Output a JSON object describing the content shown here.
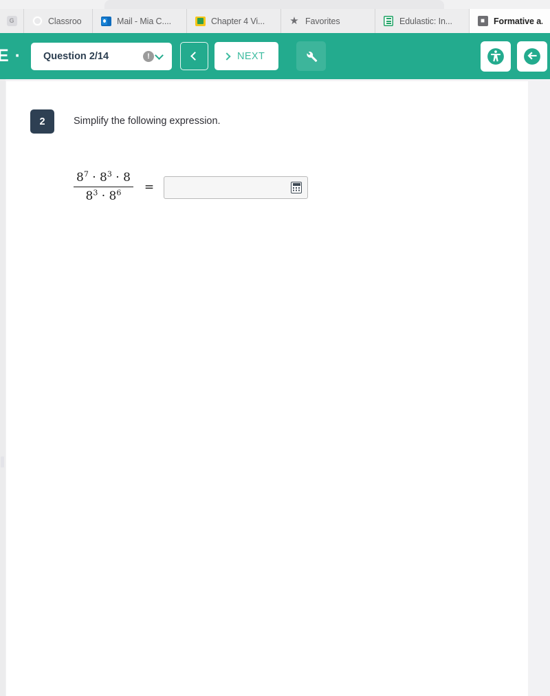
{
  "browser": {
    "tabs": [
      {
        "label": "",
        "icon": "g-suite-icon",
        "active": false,
        "pinned": true
      },
      {
        "label": "Classroo",
        "icon": "google-classroom-icon",
        "active": false,
        "pinned": false
      },
      {
        "label": "Mail - Mia C....",
        "icon": "outlook-icon",
        "active": false,
        "pinned": false
      },
      {
        "label": "Chapter 4 Vi...",
        "icon": "document-icon",
        "active": false,
        "pinned": false
      },
      {
        "label": "Favorites",
        "icon": "star-icon",
        "active": false,
        "pinned": false
      },
      {
        "label": "Edulastic: In...",
        "icon": "edulastic-icon",
        "active": false,
        "pinned": false
      },
      {
        "label": "Formative a...",
        "icon": "formative-icon",
        "active": true,
        "pinned": false
      }
    ]
  },
  "appbar": {
    "brand": "E ·",
    "question_selector": {
      "label": "Question 2/14",
      "warning_glyph": "!",
      "chevron": "chevron-down-icon"
    },
    "back_label": "",
    "next_label": "NEXT",
    "tools_icon": "wrench-icon",
    "accessibility_icon": "accessibility-icon",
    "exit_icon": "exit-icon",
    "accent_color": "#23ab8e"
  },
  "question": {
    "number": "2",
    "prompt": "Simplify the following expression.",
    "badge_color": "#2e4053",
    "expression": {
      "numerator": [
        {
          "base": "8",
          "exp": "7"
        },
        {
          "base": "8",
          "exp": "3"
        },
        {
          "base": "8",
          "exp": ""
        }
      ],
      "denominator": [
        {
          "base": "8",
          "exp": "3"
        },
        {
          "base": "8",
          "exp": "6"
        }
      ],
      "numerator_text": "8⁷ · 8³ · 8",
      "denominator_text": "8³ · 8⁶",
      "equals": "=",
      "separator": "·"
    },
    "answer": {
      "value": "",
      "placeholder": "",
      "calculator_icon": "calculator-icon"
    }
  }
}
